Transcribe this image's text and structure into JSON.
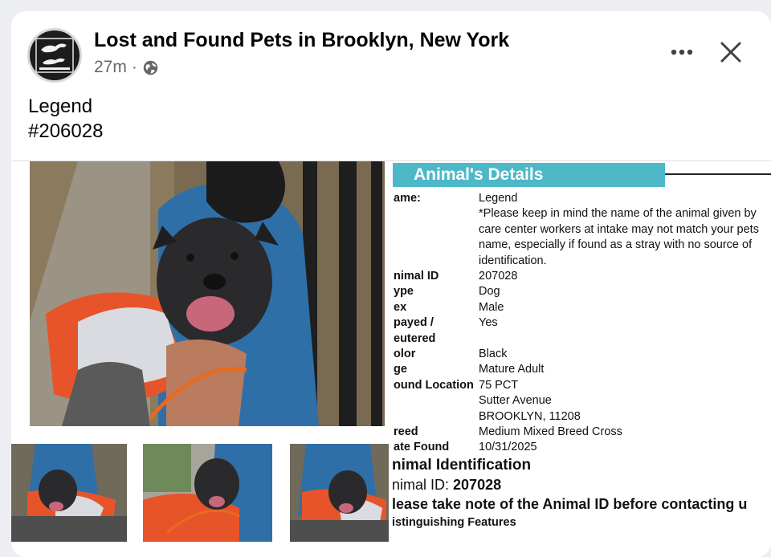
{
  "post": {
    "page_name": "Lost and Found Pets in Brooklyn, New York",
    "time_ago": "27m",
    "separator": "·",
    "text_line1": "Legend",
    "text_line2": "#206028"
  },
  "icons": {
    "more": "more-options-icon",
    "close": "close-icon",
    "audience": "globe-icon"
  },
  "details": {
    "header": "Animal's Details",
    "rows": [
      {
        "label": "ame:",
        "value": "Legend"
      },
      {
        "label": "",
        "value": "*Please keep in mind the name of the animal given by"
      },
      {
        "label": "",
        "value": "care center workers at intake may not match your pets"
      },
      {
        "label": "",
        "value": "name, especially if found as a stray with no source of"
      },
      {
        "label": "",
        "value": "identification."
      },
      {
        "label": "nimal ID",
        "value": "207028"
      },
      {
        "label": "ype",
        "value": "Dog"
      },
      {
        "label": "ex",
        "value": "Male"
      },
      {
        "label": "payed /",
        "value": "Yes"
      },
      {
        "label": "eutered",
        "value": ""
      },
      {
        "label": "olor",
        "value": "Black"
      },
      {
        "label": "ge",
        "value": "Mature Adult"
      },
      {
        "label": "ound Location",
        "value": "75 PCT"
      },
      {
        "label": "",
        "value": "Sutter Avenue"
      },
      {
        "label": "",
        "value": "BROOKLYN, 11208"
      },
      {
        "label": "reed",
        "value": "Medium Mixed Breed Cross"
      },
      {
        "label": "ate Found",
        "value": "10/31/2025"
      }
    ],
    "identification_title": "nimal Identification",
    "animal_id_label": "nimal ID: ",
    "animal_id_value": "207028",
    "notice": "lease take note of the Animal ID before contacting u",
    "features_title": "istinguishing Features"
  },
  "colors": {
    "header_teal": "#4db8c7",
    "secondary_text": "#65676b",
    "shirt_blue": "#2f6fa8",
    "vest_orange": "#e8542a"
  }
}
